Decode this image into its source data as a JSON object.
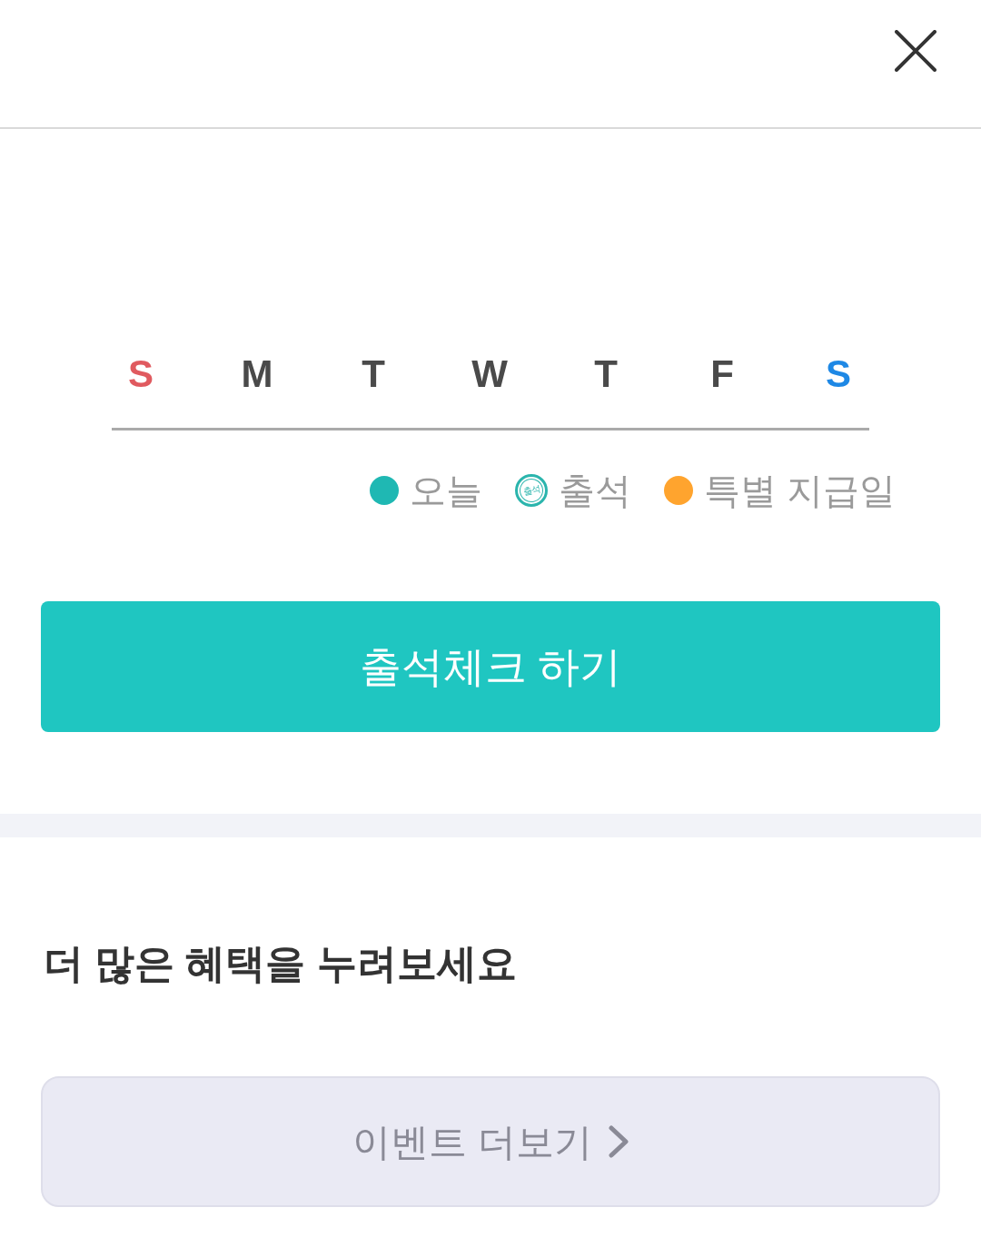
{
  "calendar": {
    "weekdays": [
      {
        "label": "S",
        "color": "#e05a5f"
      },
      {
        "label": "M",
        "color": "#4a4a4a"
      },
      {
        "label": "T",
        "color": "#4a4a4a"
      },
      {
        "label": "W",
        "color": "#4a4a4a"
      },
      {
        "label": "T",
        "color": "#4a4a4a"
      },
      {
        "label": "F",
        "color": "#4a4a4a"
      },
      {
        "label": "S",
        "color": "#1e88e5"
      }
    ]
  },
  "legend": [
    {
      "kind": "dot",
      "label": "오늘",
      "color": "#1fb8b3"
    },
    {
      "kind": "stamp",
      "label": "출석",
      "stamp_text": "출석",
      "color": "#2bb5ad"
    },
    {
      "kind": "dot",
      "label": "특별 지급일",
      "color": "#ffa42e"
    }
  ],
  "check_button": {
    "label": "출석체크 하기"
  },
  "benefits": {
    "title": "더 많은 혜택을 누려보세요",
    "more_button": {
      "label": "이벤트 더보기"
    }
  }
}
